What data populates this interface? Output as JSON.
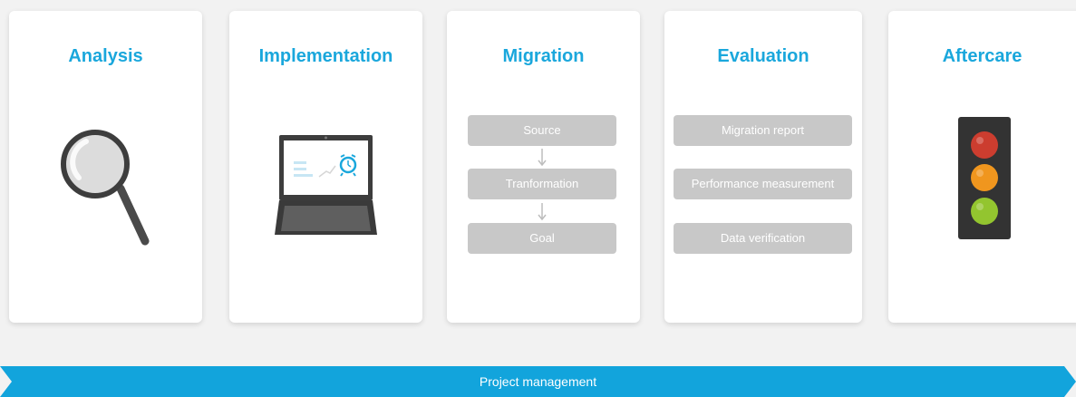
{
  "phases": [
    {
      "title": "Analysis",
      "icon": "magnifier-icon"
    },
    {
      "title": "Implementation",
      "icon": "laptop-alarm-icon"
    },
    {
      "title": "Migration",
      "icon": "flow-chart",
      "steps": [
        "Source",
        "Tranformation",
        "Goal"
      ]
    },
    {
      "title": "Evaluation",
      "icon": "report-list",
      "items": [
        "Migration report",
        "Performance measurement",
        "Data verification"
      ]
    },
    {
      "title": "Aftercare",
      "icon": "traffic-light-icon"
    }
  ],
  "banner": {
    "label": "Project management"
  },
  "colors": {
    "accent": "#1aa7dc",
    "box": "#c8c8c8",
    "banner": "#12a4dc",
    "light_red": "#cc3d2f",
    "light_orange": "#f0961e",
    "light_green": "#93c52f"
  }
}
